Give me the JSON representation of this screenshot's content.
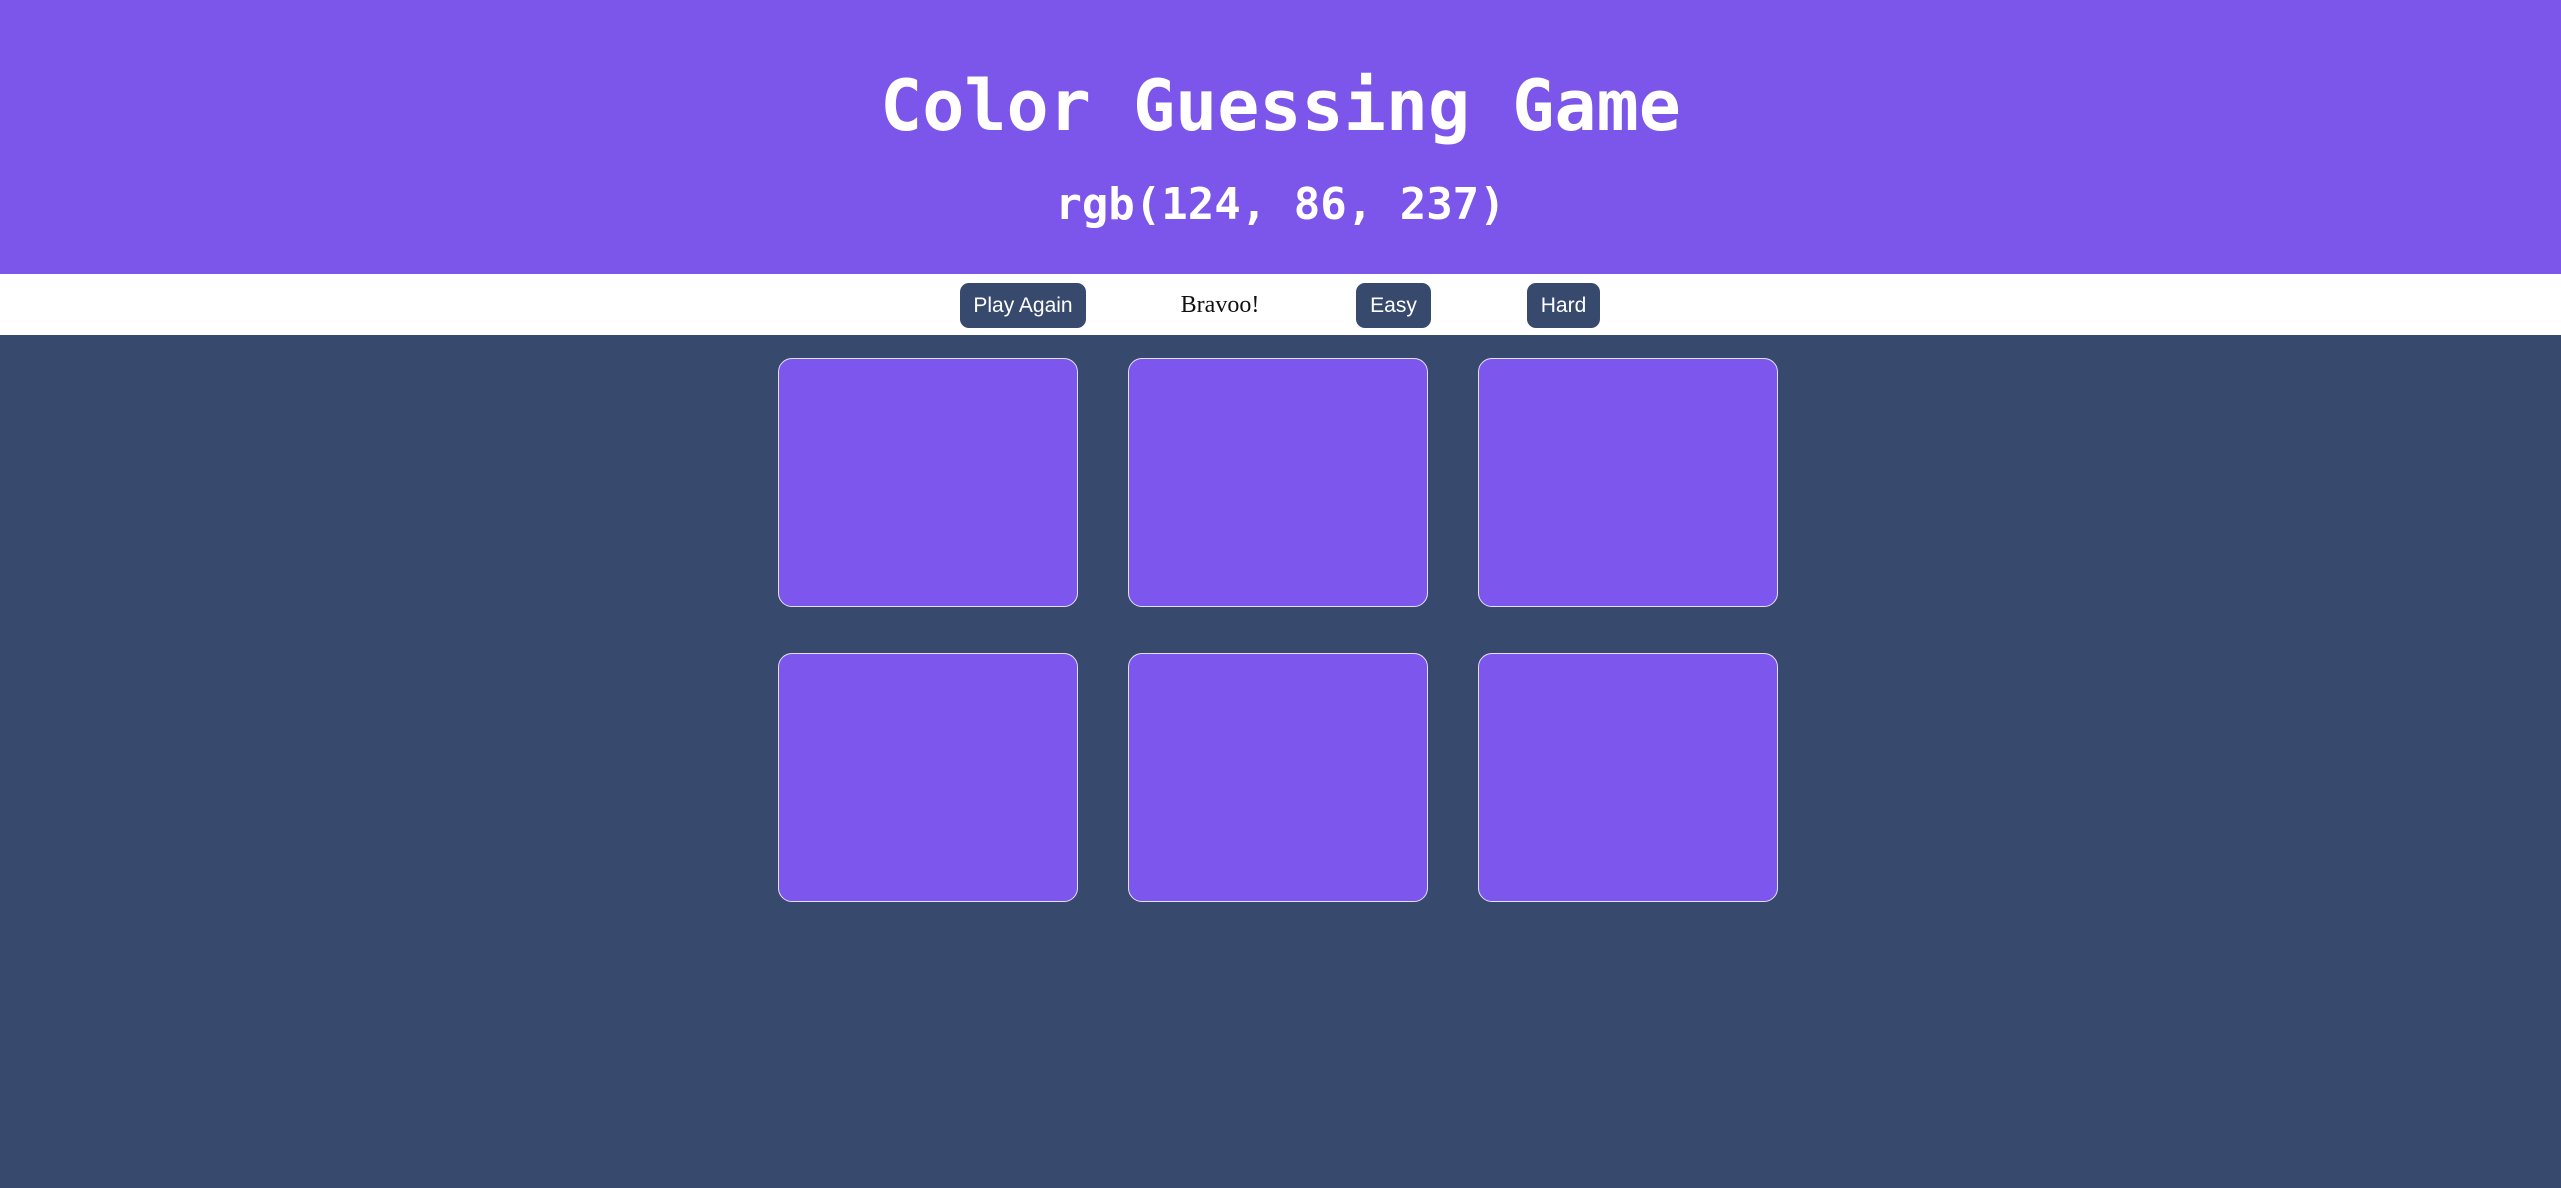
{
  "header": {
    "title": "Color Guessing Game",
    "rgb_text": "rgb(124, 86, 237)",
    "background_color": "#7C56EB"
  },
  "controls": {
    "play_again_label": "Play Again",
    "message": "Bravoo!",
    "easy_label": "Easy",
    "hard_label": "Hard",
    "button_color": "#374A6D"
  },
  "board": {
    "background_color": "#374A6D",
    "squares": [
      {
        "color": "rgb(124, 86, 237)"
      },
      {
        "color": "rgb(124, 86, 237)"
      },
      {
        "color": "rgb(124, 86, 237)"
      },
      {
        "color": "rgb(124, 86, 237)"
      },
      {
        "color": "rgb(124, 86, 237)"
      },
      {
        "color": "rgb(124, 86, 237)"
      }
    ]
  }
}
